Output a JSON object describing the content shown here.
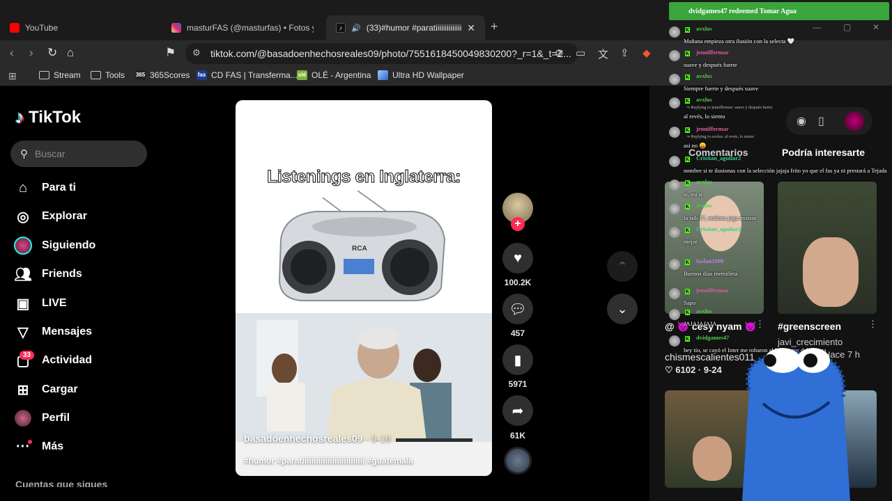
{
  "browser": {
    "tabs": [
      {
        "title": "YouTube",
        "favicon_color": "#ff0000"
      },
      {
        "title": "masturFAS (@masturfas) • Fotos y vid",
        "favicon_color": "#e1306c"
      },
      {
        "title": "(33)#humor #paratiiiiiiiiiiiiiiiii",
        "favicon_color": "#111111"
      }
    ],
    "url": "tiktok.com/@basadoenhechosreales09/photo/7551618450049830200?_r=1&_t=Z...",
    "bookmarks": [
      "Stream",
      "Tools",
      "365Scores",
      "CD FAS | Transferma...",
      "OLÉ - Argentina",
      "Ultra HD Wallpaper"
    ],
    "bookmark_badges": [
      "365",
      "fas",
      "olé"
    ]
  },
  "tiktok": {
    "logo": "TikTok",
    "search_placeholder": "Buscar",
    "nav": [
      {
        "label": "Para ti",
        "icon": "home-icon"
      },
      {
        "label": "Explorar",
        "icon": "compass-icon"
      },
      {
        "label": "Siguiendo",
        "icon": "avatar-icon"
      },
      {
        "label": "Friends",
        "icon": "friends-icon"
      },
      {
        "label": "LIVE",
        "icon": "live-icon"
      },
      {
        "label": "Mensajes",
        "icon": "send-icon"
      },
      {
        "label": "Actividad",
        "icon": "inbox-icon"
      },
      {
        "label": "Cargar",
        "icon": "plus-square-icon"
      },
      {
        "label": "Perfil",
        "icon": "profile-avatar-icon"
      },
      {
        "label": "Más",
        "icon": "more-icon"
      }
    ],
    "activity_badge": "33",
    "following_cut": "Cuentas que sigues",
    "post": {
      "overlay_title": "Listenings en Inglaterra:",
      "username": "basadoenhechosreales09",
      "date": "· 9-18",
      "tags": "#humor #paratiiiiiiiiiiiiiiiiiiiiiiiiiii #guatemala"
    },
    "actions": {
      "likes": "100.2K",
      "comments": "457",
      "saves": "5971",
      "shares": "61K"
    },
    "right_panel": {
      "tab_comments": "Comentarios",
      "tab_interest": "Podría interesarte",
      "card1_user": "@ 😈 cesy nyam 😈",
      "card1_author": "chismescalientes011",
      "card1_stats": "♡ 6102 · 9-24",
      "card2_title": "#greenscreen",
      "card2_author": "javi_crecimiento",
      "card2_time": "Hace 7 h"
    }
  },
  "stream_overlay": {
    "redeem": "dvidgames47 redeemed Tomar Agua",
    "messages": [
      {
        "user": "avxlos",
        "text": "Mañana empieza otra ilusión con la selecta 🤍",
        "color": "#4ec94e"
      },
      {
        "user": "jenniffermar",
        "text": "suave y después fuerte",
        "color": "#e05aa0"
      },
      {
        "user": "avxlos",
        "text": "Siempre fuerte y después suave",
        "color": "#4ec94e"
      },
      {
        "user": "avxlos",
        "reply": "Replying to jenniffermar: suave y después fuerte",
        "text": "al revés, lo siento",
        "color": "#4ec94e"
      },
      {
        "user": "jenniffermar",
        "reply": "Replying to avxlos: al revés, lo siento",
        "text": "asi no 😛",
        "color": "#e05aa0"
      },
      {
        "user": "Cristian_aguilar2",
        "text": "nombre si te ilusionas con la selección jajaja frito yo que el fas ya ni prestará a Tejada",
        "color": "#2fd18b"
      },
      {
        "user": "avxlos",
        "text": "si, asi si",
        "color": "#4ec94e"
      },
      {
        "user": "avxlos",
        "text": "la sub 17, mañana juga mossss",
        "color": "#4ec94e"
      },
      {
        "user": "Cristian_aguilar2",
        "text": "mejor",
        "color": "#2fd18b"
      },
      {
        "user": "fasfan1990",
        "text": "Buenos dias metralleta",
        "color": "#c37af0"
      },
      {
        "user": "jenniffermar",
        "text": "Sapo",
        "color": "#e05aa0"
      },
      {
        "user": "avxlos",
        "text": "JAJAJAJAJA",
        "color": "#4ec94e"
      },
      {
        "user": "dvidgames47",
        "text": "hey tío, se cayó el Inter me robaron al Inter estos del alianza",
        "color": "#4ec94e"
      }
    ]
  },
  "colors": {
    "accent": "#fe2c55",
    "tiktok_cyan": "#25f4ee",
    "kick_green": "#53fc18"
  }
}
